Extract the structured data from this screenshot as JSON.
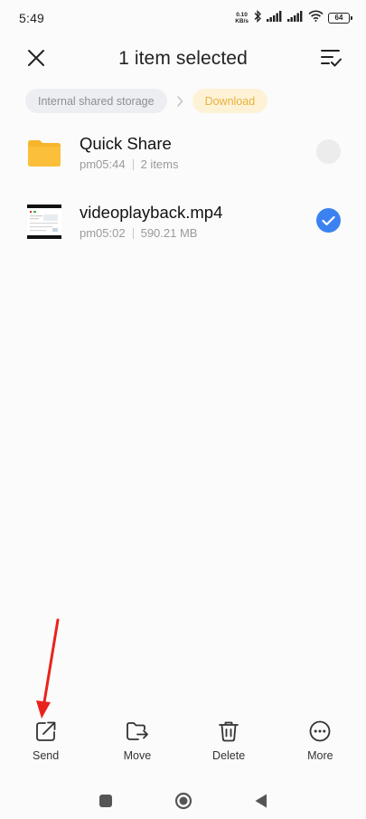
{
  "status_bar": {
    "time": "5:49",
    "net_speed_value": "0.10",
    "net_speed_unit": "KB/s",
    "battery": "64"
  },
  "header": {
    "title": "1 item selected"
  },
  "breadcrumb": {
    "items": [
      "Internal shared storage",
      "Download"
    ]
  },
  "files": [
    {
      "name": "Quick Share",
      "time": "pm05:44",
      "detail": "2 items",
      "type": "folder",
      "selected": false
    },
    {
      "name": "videoplayback.mp4",
      "time": "pm05:02",
      "detail": "590.21 MB",
      "type": "video",
      "selected": true
    }
  ],
  "actions": [
    {
      "label": "Send",
      "icon": "send-icon"
    },
    {
      "label": "Move",
      "icon": "move-icon"
    },
    {
      "label": "Delete",
      "icon": "trash-icon"
    },
    {
      "label": "More",
      "icon": "more-icon"
    }
  ],
  "colors": {
    "accent": "#3b82f0",
    "folder": "#f7b52c",
    "breadcrumb_active": "#e8b23c",
    "annotation": "#e8231d"
  }
}
